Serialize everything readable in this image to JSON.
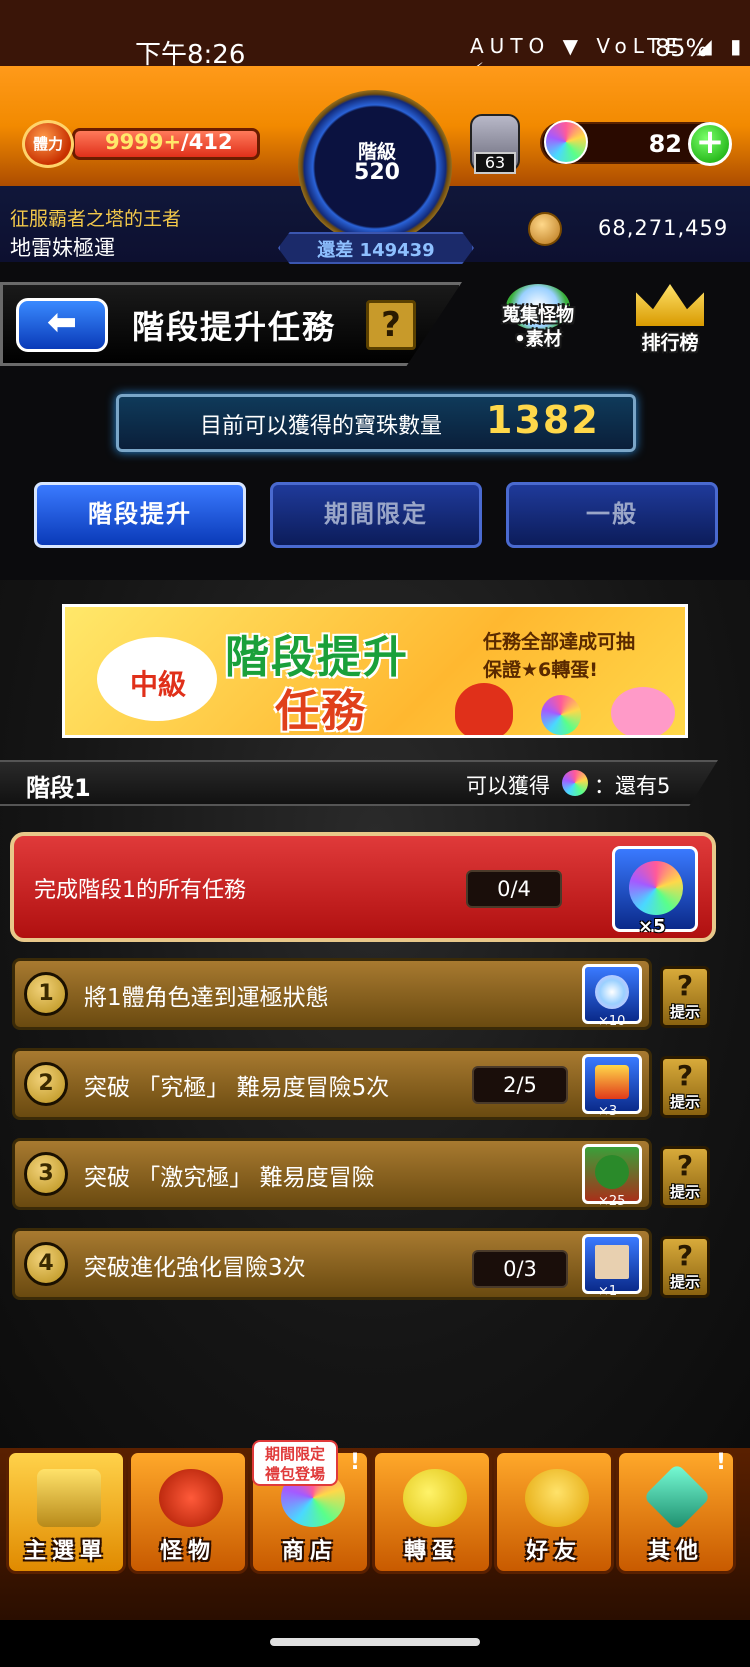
{
  "status_bar": {
    "time": "下午8:26",
    "icons": "AUTO ▼ VoLTE ◢ ▮ ⚡",
    "battery_pct": "85%"
  },
  "header": {
    "stamina_icon_label": "體力",
    "stamina_current": "9999+",
    "stamina_max": "/412",
    "rank_label": "階級",
    "rank_value": "520",
    "rank_remaining": "還差 149439",
    "egg_count": "63",
    "orb_count": "82",
    "player_title": "征服霸者之塔的王者",
    "username": "地雷妹極運",
    "coin_count": "68,271,459"
  },
  "title_bar": {
    "back_label": "⬅",
    "title": "階段提升任務",
    "help_label": "?",
    "collect_label_1": "蒐集怪物",
    "collect_label_2": "•素材",
    "ranking_label": "排行榜"
  },
  "orbs_available": {
    "label": "目前可以獲得的寶珠數量",
    "value": "1382"
  },
  "tabs": [
    {
      "label": "階段提升",
      "active": true
    },
    {
      "label": "期間限定",
      "active": false
    },
    {
      "label": "一般",
      "active": false
    }
  ],
  "banner": {
    "level": "中級",
    "title_1": "階段提升",
    "title_2": "任務",
    "note_1": "任務全部達成可抽",
    "note_2": "保證★6轉蛋!"
  },
  "stage": {
    "title": "階段1",
    "reward_prefix": "可以獲得",
    "reward_remaining": "：還有5"
  },
  "complete_all": {
    "label": "完成階段1的所有任務",
    "progress": "0/4",
    "reward_qty": "×5"
  },
  "missions": [
    {
      "num": "1",
      "label": "將1體角色達到運極狀態",
      "progress": "",
      "reward_qty": "×10",
      "hint_q": "?",
      "hint_label": "提示"
    },
    {
      "num": "2",
      "label": "突破 「究極」 難易度冒險5次",
      "progress": "2/5",
      "reward_qty": "×3",
      "hint_q": "?",
      "hint_label": "提示"
    },
    {
      "num": "3",
      "label": "突破 「激究極」 難易度冒險",
      "progress": "",
      "reward_qty": "×25",
      "hint_q": "?",
      "hint_label": "提示"
    },
    {
      "num": "4",
      "label": "突破進化強化冒險3次",
      "progress": "0/3",
      "reward_qty": "×1",
      "hint_q": "?",
      "hint_label": "提示"
    }
  ],
  "bottom_nav": {
    "items": [
      {
        "label": "主選單"
      },
      {
        "label": "怪物"
      },
      {
        "label": "商店"
      },
      {
        "label": "轉蛋"
      },
      {
        "label": "好友"
      },
      {
        "label": "其他"
      }
    ],
    "shop_badge_1": "期間限定",
    "shop_badge_2": "禮包登場",
    "alert": "!"
  },
  "colors": {
    "accent_orange": "#f28a00",
    "tab_active": "#3a7aff",
    "orb_value": "#ffd84a",
    "mission_red": "#b01010",
    "mission_gold": "#a87a30"
  }
}
